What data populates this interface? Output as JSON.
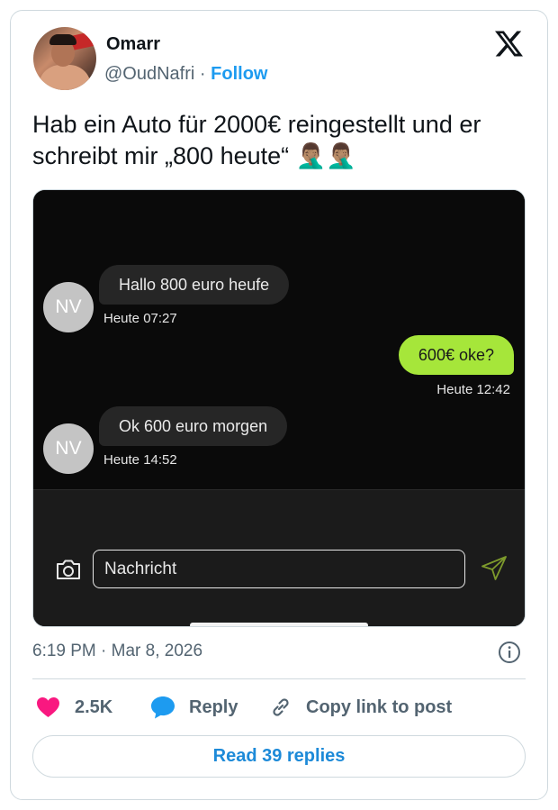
{
  "author": {
    "name": "Omarr",
    "handle": "@OudNafri",
    "separator": "·",
    "follow_label": "Follow"
  },
  "tweet": {
    "text": "Hab ein Auto für 2000€ reingestellt und er schreibt mir „800 heute“ 🤦🏽‍♂️🤦🏽‍♂️",
    "time": "6:19 PM",
    "date_separator": "·",
    "date": "Mar 8, 2026"
  },
  "screenshot_chat": {
    "messages": [
      {
        "direction": "in",
        "avatar_initials": "NV",
        "text": "Hallo 800 euro heufe",
        "time": "Heute 07:27"
      },
      {
        "direction": "out",
        "text": "600€ oke?",
        "time": "Heute 12:42"
      },
      {
        "direction": "in",
        "avatar_initials": "NV",
        "text": "Ok 600 euro morgen",
        "time": "Heute 14:52"
      }
    ],
    "input_placeholder": "Nachricht",
    "icons": {
      "camera": "camera-icon",
      "send": "send-icon"
    },
    "colors": {
      "outgoing_bubble": "#a6e63a",
      "incoming_bubble": "#262626",
      "background": "#0a0a0a"
    }
  },
  "actions": {
    "likes_count": "2.5K",
    "reply_label": "Reply",
    "copy_link_label": "Copy link to post",
    "icons": {
      "like": "heart-icon",
      "reply": "speech-bubble-icon",
      "copy": "link-icon",
      "info": "info-icon",
      "brand": "x-logo-icon"
    }
  },
  "read_replies_label": "Read 39 replies",
  "colors": {
    "accent": "#1d9bf0",
    "like": "#f91880",
    "reply_icon": "#1d9bf0",
    "muted": "#536471"
  }
}
